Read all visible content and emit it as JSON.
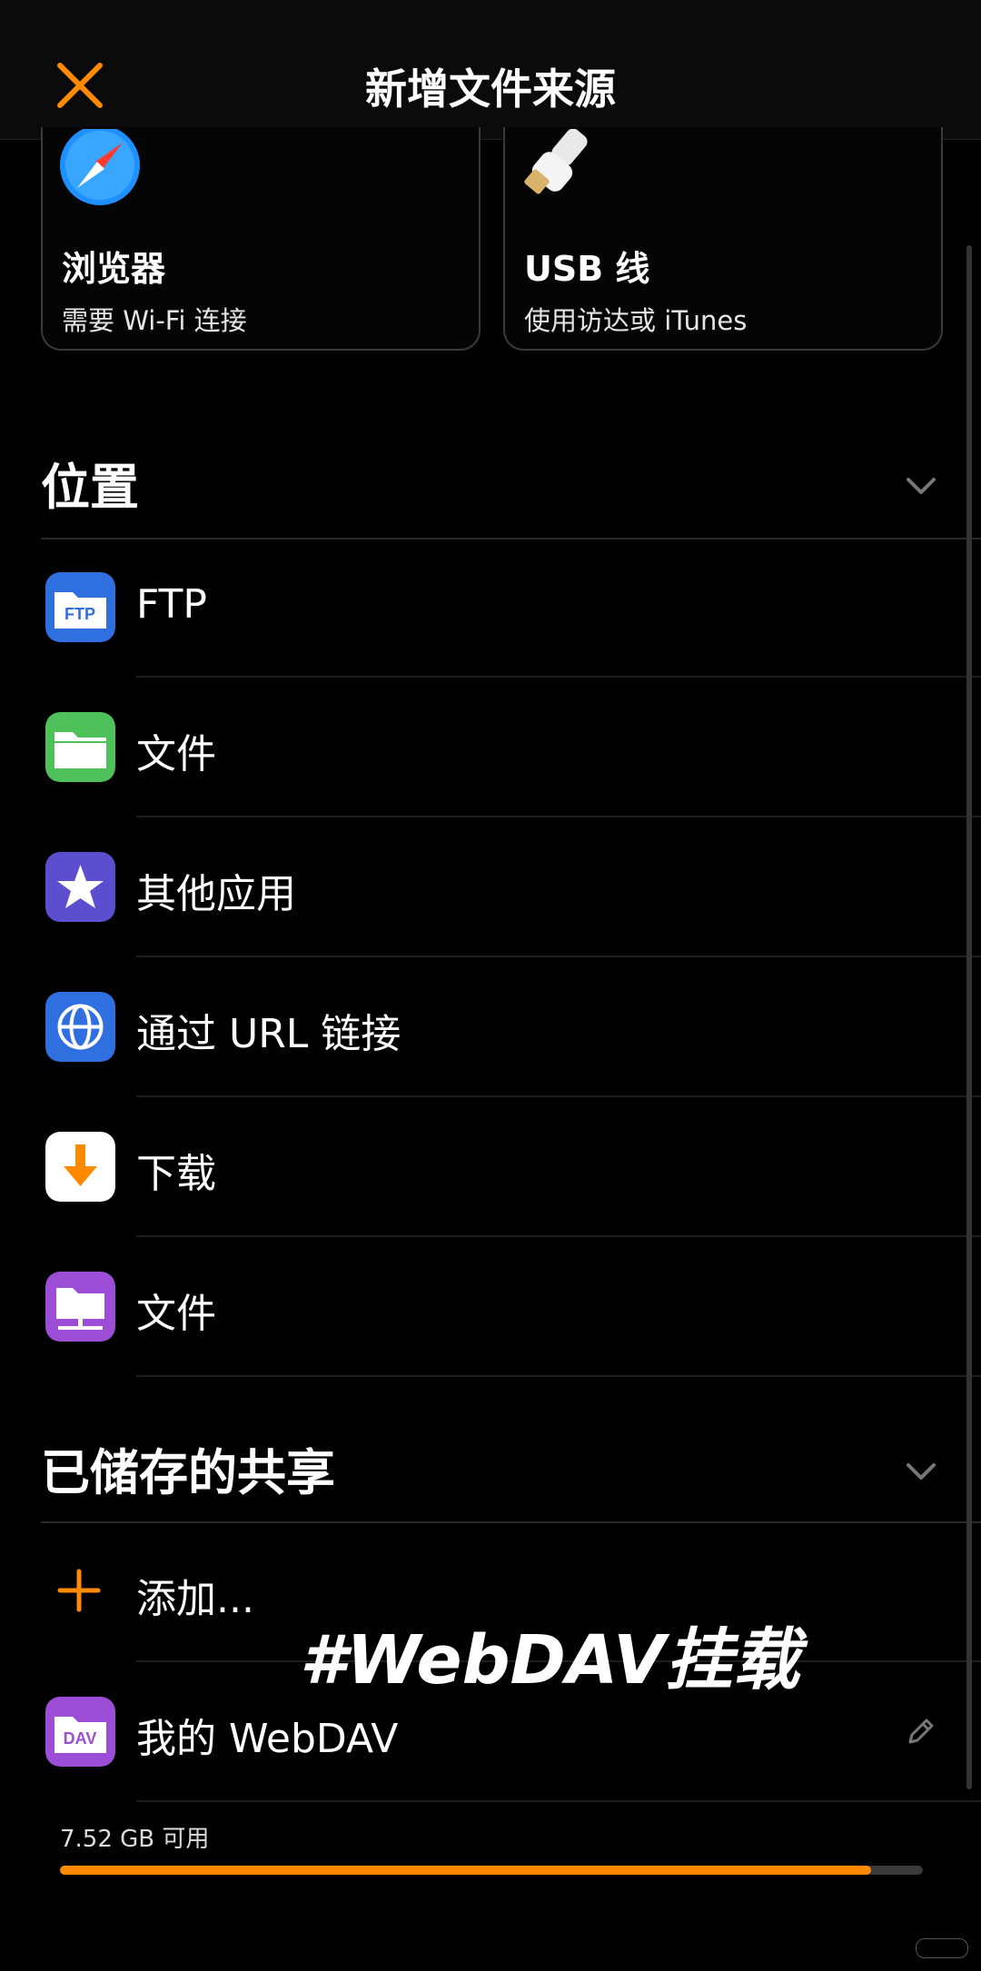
{
  "header": {
    "title": "新增文件来源",
    "close_icon": "close-icon"
  },
  "cards": [
    {
      "title": "浏览器",
      "subtitle": "需要 Wi-Fi 连接",
      "icon": "compass-icon"
    },
    {
      "title": "USB 线",
      "subtitle": "使用访达或 iTunes",
      "icon": "usb-cable-icon"
    }
  ],
  "locations": {
    "title": "位置",
    "items": [
      {
        "label": "FTP",
        "icon": "ftp-folder-icon",
        "color": "#2f6fe0"
      },
      {
        "label": "文件",
        "icon": "folder-icon",
        "color": "#4fc15a"
      },
      {
        "label": "其他应用",
        "icon": "star-icon",
        "color": "#5b4fd0"
      },
      {
        "label": "通过 URL 链接",
        "icon": "globe-icon",
        "color": "#2f6fe0"
      },
      {
        "label": "下载",
        "icon": "download-arrow-icon",
        "color": "#ffffff"
      },
      {
        "label": "文件",
        "icon": "network-folder-icon",
        "color": "#9c4fd6"
      }
    ]
  },
  "saved_shares": {
    "title": "已储存的共享",
    "add_label": "添加...",
    "items": [
      {
        "label": "我的 WebDAV",
        "icon": "dav-folder-icon",
        "color": "#9c4fd6"
      }
    ]
  },
  "storage": {
    "text": "7.52 GB 可用",
    "used_fraction": 0.94
  },
  "watermark": "#WebDAV挂载",
  "colors": {
    "accent": "#ff8a00",
    "background": "#000000"
  }
}
